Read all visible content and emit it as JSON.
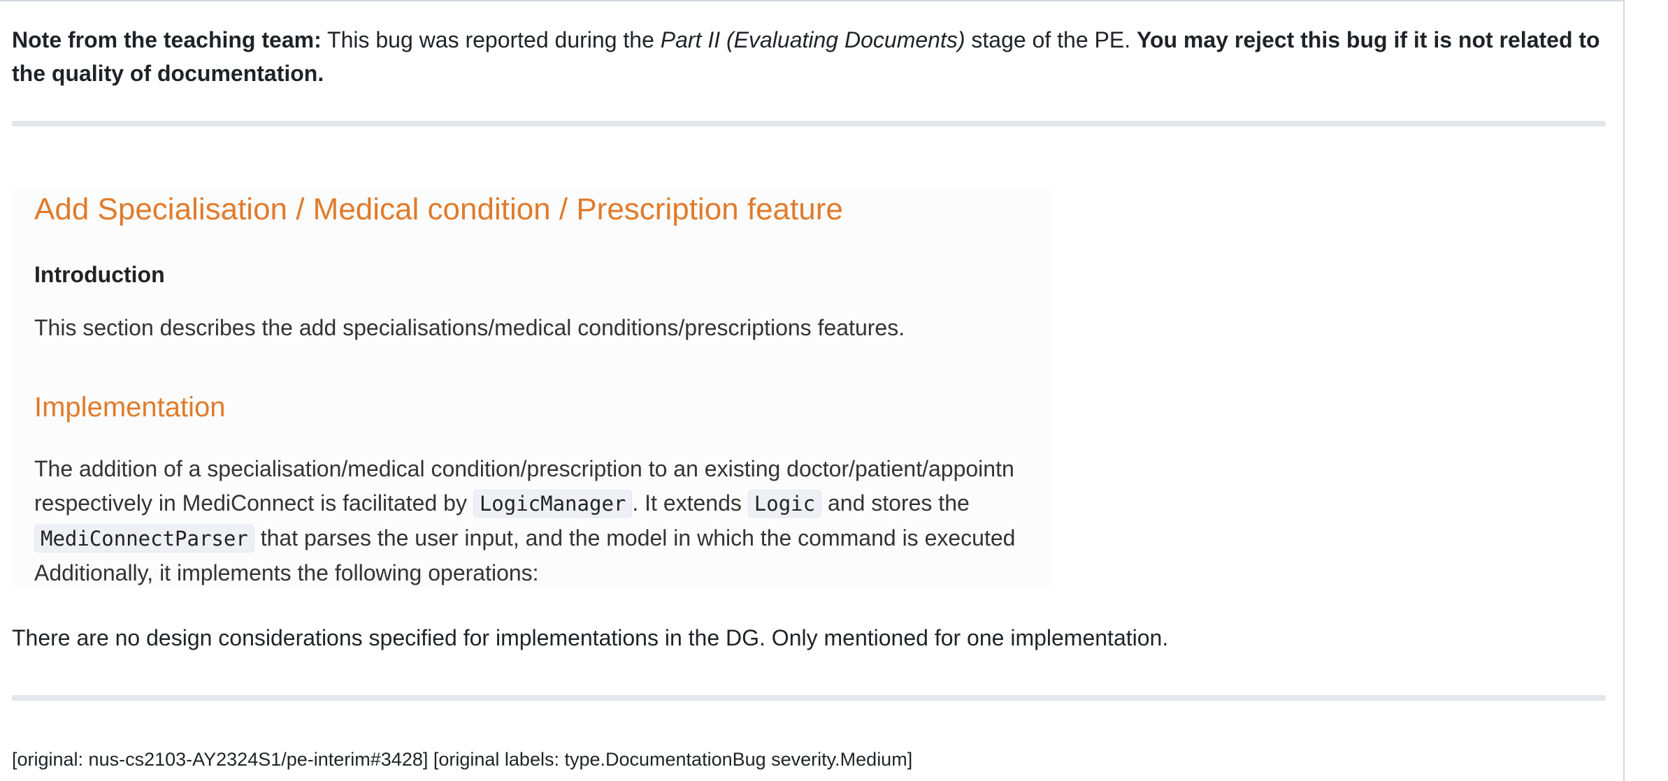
{
  "note": {
    "lead": "Note from the teaching team:",
    "text1": " This bug was reported during the ",
    "stage": "Part II (Evaluating Documents)",
    "text2": " stage of the PE. ",
    "emphasis": "You may reject this bug if it is not related to the quality of documentation."
  },
  "screenshot": {
    "heading": "Add Specialisation / Medical condition / Prescription feature",
    "intro_heading": "Introduction",
    "intro_text": "This section describes the add specialisations/medical conditions/prescriptions features.",
    "impl_heading": "Implementation",
    "line1": "The addition of a specialisation/medical condition/prescription to an existing doctor/patient/appointn",
    "line2_a": "respectively in MediConnect is facilitated by ",
    "code1": "LogicManager",
    "line2_b": ". It extends ",
    "code2": "Logic",
    "line2_c": " and stores the",
    "code3": "MediConnectParser",
    "line3": " that parses the user input, and the model in which the command is executed",
    "line4": "Additionally, it implements the following operations:"
  },
  "comment": "There are no design considerations specified for implementations in the DG. Only mentioned for one implementation.",
  "original": "[original: nus-cs2103-AY2324S1/pe-interim#3428] [original labels: type.DocumentationBug severity.Medium]",
  "colors": {
    "heading_accent": "#e07b2b"
  }
}
